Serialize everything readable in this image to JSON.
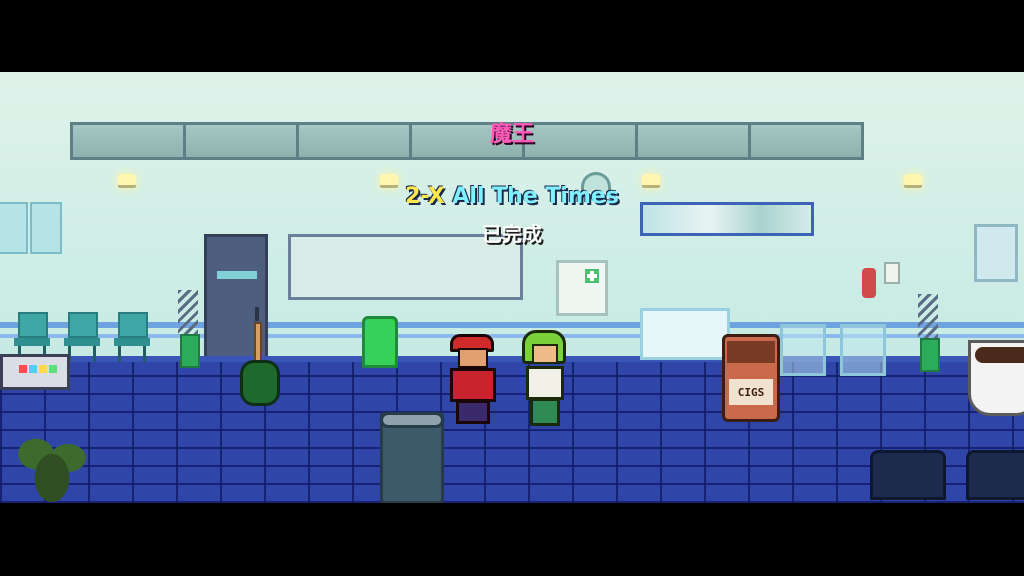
{
  "hud": {
    "boss_name": "魔王",
    "level_code": "2-X",
    "level_name": "All The Times",
    "status": "已完成"
  },
  "props": {
    "jar_label": "CIGS"
  },
  "colors": {
    "boss_name": "#ff5ab7",
    "level_code": "#ffe94a",
    "level_name": "#7ef0ff",
    "status": "#ffffff",
    "floor": "#2f45a8",
    "wall": "#dff3ea"
  },
  "icons": {
    "first_aid": "first-aid-cross-icon",
    "clock": "wall-clock-icon",
    "calendar": "calendar-icon"
  }
}
